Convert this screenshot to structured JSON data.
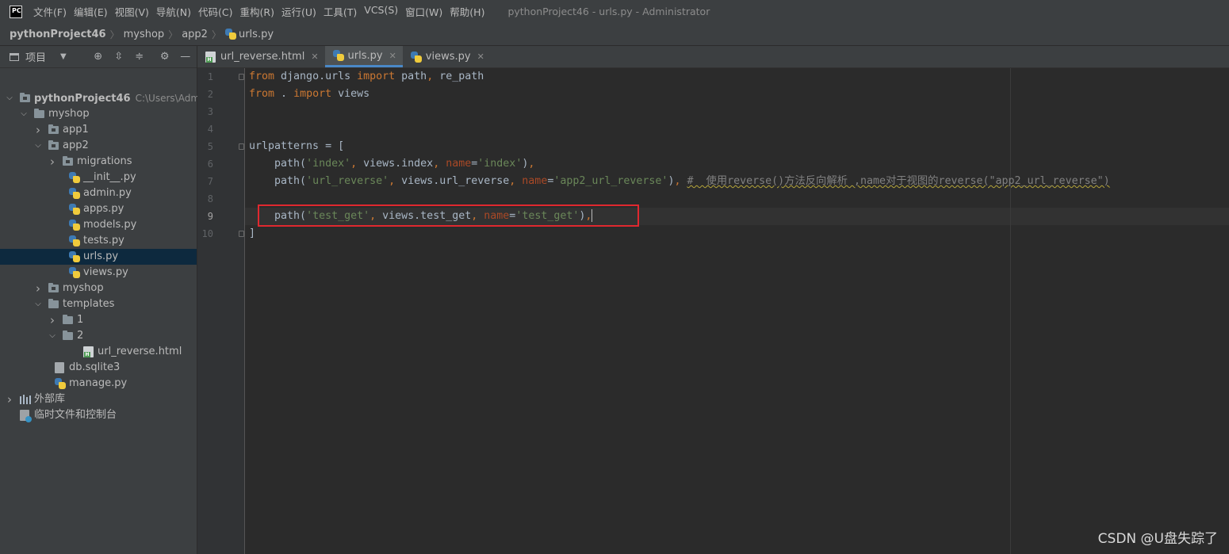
{
  "titlebar": {
    "app_logo": "PC",
    "menu": [
      "文件(F)",
      "编辑(E)",
      "视图(V)",
      "导航(N)",
      "代码(C)",
      "重构(R)",
      "运行(U)",
      "工具(T)",
      "VCS(S)",
      "窗口(W)",
      "帮助(H)"
    ],
    "window_title": "pythonProject46 - urls.py - Administrator"
  },
  "breadcrumb": {
    "items": [
      "pythonProject46",
      "myshop",
      "app2",
      "urls.py"
    ]
  },
  "sidebar": {
    "header_label": "项目",
    "tree": [
      {
        "label": "pythonProject46",
        "hint": "C:\\Users\\Adminis",
        "kind": "module",
        "depth": 0,
        "arrow": "open"
      },
      {
        "label": "myshop",
        "kind": "folder",
        "depth": 1,
        "arrow": "open"
      },
      {
        "label": "app1",
        "kind": "module",
        "depth": 2,
        "arrow": "closed"
      },
      {
        "label": "app2",
        "kind": "module",
        "depth": 2,
        "arrow": "open"
      },
      {
        "label": "migrations",
        "kind": "module",
        "depth": 3,
        "arrow": "closed"
      },
      {
        "label": "__init__.py",
        "kind": "py",
        "depth": 4,
        "arrow": "none"
      },
      {
        "label": "admin.py",
        "kind": "py",
        "depth": 4,
        "arrow": "none"
      },
      {
        "label": "apps.py",
        "kind": "py",
        "depth": 4,
        "arrow": "none"
      },
      {
        "label": "models.py",
        "kind": "py",
        "depth": 4,
        "arrow": "none"
      },
      {
        "label": "tests.py",
        "kind": "py",
        "depth": 4,
        "arrow": "none"
      },
      {
        "label": "urls.py",
        "kind": "py",
        "depth": 4,
        "arrow": "none",
        "selected": true
      },
      {
        "label": "views.py",
        "kind": "py",
        "depth": 4,
        "arrow": "none"
      },
      {
        "label": "myshop",
        "kind": "module",
        "depth": 2,
        "arrow": "closed"
      },
      {
        "label": "templates",
        "kind": "folder",
        "depth": 2,
        "arrow": "open"
      },
      {
        "label": "1",
        "kind": "folder",
        "depth": 3,
        "arrow": "closed"
      },
      {
        "label": "2",
        "kind": "folder",
        "depth": 3,
        "arrow": "open"
      },
      {
        "label": "url_reverse.html",
        "kind": "html",
        "depth": 5,
        "arrow": "none"
      },
      {
        "label": "db.sqlite3",
        "kind": "db",
        "depth": 3,
        "arrow": "none"
      },
      {
        "label": "manage.py",
        "kind": "py",
        "depth": 3,
        "arrow": "none"
      },
      {
        "label": "外部库",
        "kind": "lib",
        "depth": 0,
        "arrow": "closed"
      },
      {
        "label": "临时文件和控制台",
        "kind": "scratch",
        "depth": 0,
        "arrow": "none"
      }
    ]
  },
  "tabs": [
    {
      "label": "url_reverse.html",
      "icon": "html-file-icon",
      "active": false
    },
    {
      "label": "urls.py",
      "icon": "python-file-icon",
      "active": true
    },
    {
      "label": "views.py",
      "icon": "python-file-icon",
      "active": false
    }
  ],
  "editor": {
    "line_numbers": [
      "1",
      "2",
      "3",
      "4",
      "5",
      "6",
      "7",
      "8",
      "9",
      "10"
    ],
    "current_line": "9",
    "lines": [
      [
        [
          "kw",
          "from"
        ],
        [
          "t",
          " django.urls "
        ],
        [
          "kw",
          "import"
        ],
        [
          "t",
          " path"
        ],
        [
          "kw",
          ","
        ],
        [
          "t",
          " re_path"
        ]
      ],
      [
        [
          "kw",
          "from"
        ],
        [
          "t",
          " . "
        ],
        [
          "kw",
          "import"
        ],
        [
          "t",
          " views"
        ]
      ],
      [],
      [],
      [
        [
          "t",
          "urlpatterns = ["
        ]
      ],
      [
        [
          "t",
          "    path("
        ],
        [
          "str",
          "'index'"
        ],
        [
          "kw",
          ","
        ],
        [
          "t",
          " views.index"
        ],
        [
          "kw",
          ","
        ],
        [
          "t",
          " "
        ],
        [
          "nm",
          "name"
        ],
        [
          "t",
          "="
        ],
        [
          "str",
          "'index'"
        ],
        [
          "t",
          ")"
        ],
        [
          "kw",
          ","
        ]
      ],
      [
        [
          "t",
          "    path("
        ],
        [
          "str",
          "'url_reverse'"
        ],
        [
          "kw",
          ","
        ],
        [
          "t",
          " views.url_reverse"
        ],
        [
          "kw",
          ","
        ],
        [
          "t",
          " "
        ],
        [
          "nm",
          "name"
        ],
        [
          "t",
          "="
        ],
        [
          "str",
          "'app2_url_reverse'"
        ],
        [
          "t",
          ")"
        ],
        [
          "kw",
          ","
        ],
        [
          "t",
          " "
        ],
        [
          "cmt",
          "#  使用reverse()方法反向解析 ,name对于视图的reverse(\"app2_url_reverse\")"
        ]
      ],
      [],
      [
        [
          "t",
          "    path("
        ],
        [
          "str",
          "'test_get'"
        ],
        [
          "kw",
          ","
        ],
        [
          "t",
          " views.test_get"
        ],
        [
          "kw",
          ","
        ],
        [
          "t",
          " "
        ],
        [
          "nm",
          "name"
        ],
        [
          "t",
          "="
        ],
        [
          "str",
          "'test_get'"
        ],
        [
          "t",
          ")"
        ],
        [
          "kw",
          ","
        ],
        [
          "cursor",
          ""
        ]
      ],
      [
        [
          "t",
          "]"
        ]
      ]
    ]
  },
  "watermark": "CSDN @U盘失踪了",
  "colors": {
    "background": "#2b2b2b",
    "keyword": "#cc7832",
    "string": "#6a8759",
    "param_name": "#aa4926",
    "highlight_box": "#e0282f",
    "selected_row": "#0d293e",
    "active_tab_underline": "#4a88c7"
  }
}
